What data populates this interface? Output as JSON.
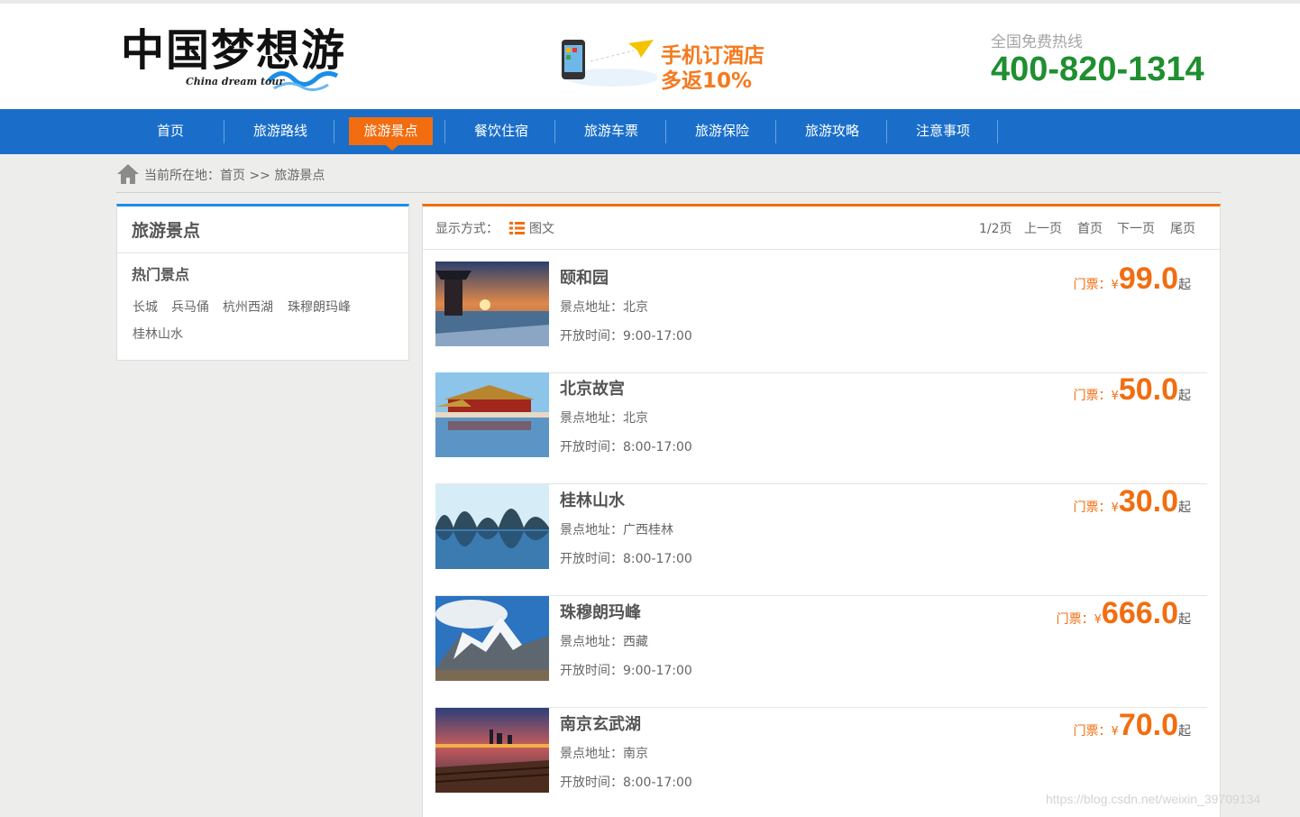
{
  "header": {
    "logo_cn": "中国梦想游",
    "logo_en": "China dream tour",
    "promo_line1": "手机订酒店",
    "promo_line2": "多返10%",
    "hotline_label": "全国免费热线",
    "hotline_number": "400-820-1314"
  },
  "nav": {
    "items": [
      {
        "label": "首页"
      },
      {
        "label": "旅游路线"
      },
      {
        "label": "旅游景点"
      },
      {
        "label": "餐饮住宿"
      },
      {
        "label": "旅游车票"
      },
      {
        "label": "旅游保险"
      },
      {
        "label": "旅游攻略"
      },
      {
        "label": "注意事项"
      }
    ],
    "active_index": 2
  },
  "breadcrumb": {
    "text": "当前所在地：首页 >> 旅游景点"
  },
  "sidebar": {
    "title": "旅游景点",
    "section_title": "热门景点",
    "links": [
      "长城",
      "兵马俑",
      "杭州西湖",
      "珠穆朗玛峰",
      "桂林山水"
    ]
  },
  "toolbar": {
    "display_label": "显示方式：",
    "display_mode": "图文",
    "page_info": "1/2页",
    "prev": "上一页",
    "first": "首页",
    "next": "下一页",
    "last": "尾页"
  },
  "items": [
    {
      "name": "颐和园",
      "address": "景点地址：北京",
      "hours": "开放时间：9:00-17:00",
      "price_label": "门票：",
      "currency": "¥",
      "price": "99.0",
      "suffix": "起"
    },
    {
      "name": "北京故宫",
      "address": "景点地址：北京",
      "hours": "开放时间：8:00-17:00",
      "price_label": "门票：",
      "currency": "¥",
      "price": "50.0",
      "suffix": "起"
    },
    {
      "name": "桂林山水",
      "address": "景点地址：广西桂林",
      "hours": "开放时间：8:00-17:00",
      "price_label": "门票：",
      "currency": "¥",
      "price": "30.0",
      "suffix": "起"
    },
    {
      "name": "珠穆朗玛峰",
      "address": "景点地址：西藏",
      "hours": "开放时间：9:00-17:00",
      "price_label": "门票：",
      "currency": "¥",
      "price": "666.0",
      "suffix": "起"
    },
    {
      "name": "南京玄武湖",
      "address": "景点地址：南京",
      "hours": "开放时间：8:00-17:00",
      "price_label": "门票：",
      "currency": "¥",
      "price": "70.0",
      "suffix": "起"
    }
  ],
  "watermark": "https://blog.csdn.net/weixin_39709134",
  "colors": {
    "nav_bg": "#1a6ec9",
    "accent_orange": "#f26d10",
    "hotline_green": "#1f8f2f",
    "sidebar_top_border": "#1a8ee8"
  }
}
